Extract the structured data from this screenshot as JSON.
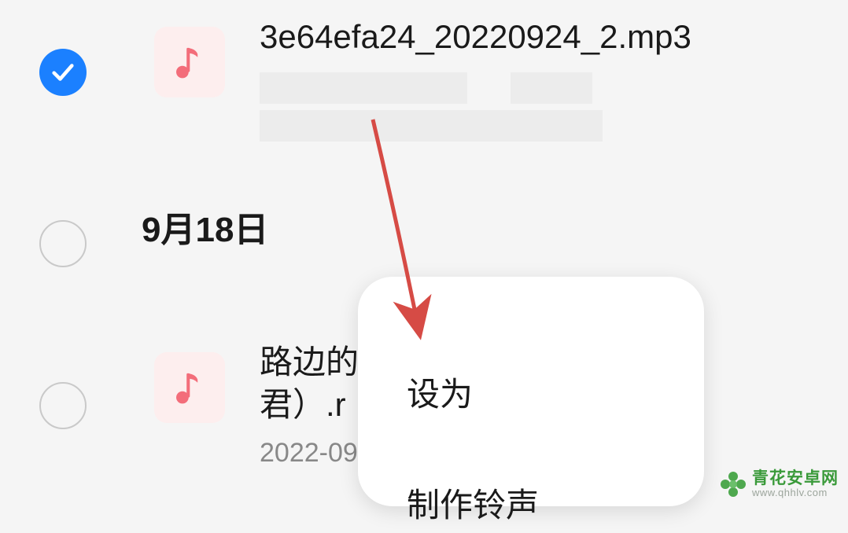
{
  "files": [
    {
      "name": "3e64efa24_20220924_2.mp3",
      "checked": true
    },
    {
      "name_partial": "路边的",
      "name_partial2": "君）.r",
      "date": "2022-09",
      "checked": false
    }
  ],
  "date_header": "9月18日",
  "popup": {
    "items": [
      "设为",
      "制作铃声"
    ]
  },
  "watermark": {
    "name": "青花安卓网",
    "url": "www.qhhlv.com"
  }
}
